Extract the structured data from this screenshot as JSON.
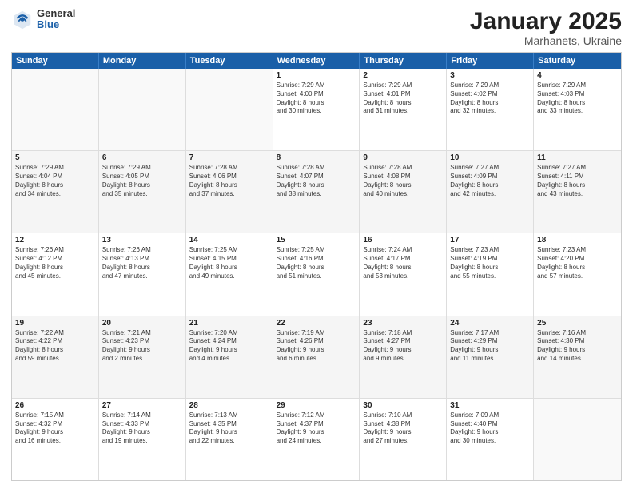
{
  "header": {
    "logo": {
      "general": "General",
      "blue": "Blue"
    },
    "title": "January 2025",
    "location": "Marhanets, Ukraine"
  },
  "days_of_week": [
    "Sunday",
    "Monday",
    "Tuesday",
    "Wednesday",
    "Thursday",
    "Friday",
    "Saturday"
  ],
  "weeks": [
    [
      {
        "day": "",
        "content": ""
      },
      {
        "day": "",
        "content": ""
      },
      {
        "day": "",
        "content": ""
      },
      {
        "day": "1",
        "content": "Sunrise: 7:29 AM\nSunset: 4:00 PM\nDaylight: 8 hours\nand 30 minutes."
      },
      {
        "day": "2",
        "content": "Sunrise: 7:29 AM\nSunset: 4:01 PM\nDaylight: 8 hours\nand 31 minutes."
      },
      {
        "day": "3",
        "content": "Sunrise: 7:29 AM\nSunset: 4:02 PM\nDaylight: 8 hours\nand 32 minutes."
      },
      {
        "day": "4",
        "content": "Sunrise: 7:29 AM\nSunset: 4:03 PM\nDaylight: 8 hours\nand 33 minutes."
      }
    ],
    [
      {
        "day": "5",
        "content": "Sunrise: 7:29 AM\nSunset: 4:04 PM\nDaylight: 8 hours\nand 34 minutes."
      },
      {
        "day": "6",
        "content": "Sunrise: 7:29 AM\nSunset: 4:05 PM\nDaylight: 8 hours\nand 35 minutes."
      },
      {
        "day": "7",
        "content": "Sunrise: 7:28 AM\nSunset: 4:06 PM\nDaylight: 8 hours\nand 37 minutes."
      },
      {
        "day": "8",
        "content": "Sunrise: 7:28 AM\nSunset: 4:07 PM\nDaylight: 8 hours\nand 38 minutes."
      },
      {
        "day": "9",
        "content": "Sunrise: 7:28 AM\nSunset: 4:08 PM\nDaylight: 8 hours\nand 40 minutes."
      },
      {
        "day": "10",
        "content": "Sunrise: 7:27 AM\nSunset: 4:09 PM\nDaylight: 8 hours\nand 42 minutes."
      },
      {
        "day": "11",
        "content": "Sunrise: 7:27 AM\nSunset: 4:11 PM\nDaylight: 8 hours\nand 43 minutes."
      }
    ],
    [
      {
        "day": "12",
        "content": "Sunrise: 7:26 AM\nSunset: 4:12 PM\nDaylight: 8 hours\nand 45 minutes."
      },
      {
        "day": "13",
        "content": "Sunrise: 7:26 AM\nSunset: 4:13 PM\nDaylight: 8 hours\nand 47 minutes."
      },
      {
        "day": "14",
        "content": "Sunrise: 7:25 AM\nSunset: 4:15 PM\nDaylight: 8 hours\nand 49 minutes."
      },
      {
        "day": "15",
        "content": "Sunrise: 7:25 AM\nSunset: 4:16 PM\nDaylight: 8 hours\nand 51 minutes."
      },
      {
        "day": "16",
        "content": "Sunrise: 7:24 AM\nSunset: 4:17 PM\nDaylight: 8 hours\nand 53 minutes."
      },
      {
        "day": "17",
        "content": "Sunrise: 7:23 AM\nSunset: 4:19 PM\nDaylight: 8 hours\nand 55 minutes."
      },
      {
        "day": "18",
        "content": "Sunrise: 7:23 AM\nSunset: 4:20 PM\nDaylight: 8 hours\nand 57 minutes."
      }
    ],
    [
      {
        "day": "19",
        "content": "Sunrise: 7:22 AM\nSunset: 4:22 PM\nDaylight: 8 hours\nand 59 minutes."
      },
      {
        "day": "20",
        "content": "Sunrise: 7:21 AM\nSunset: 4:23 PM\nDaylight: 9 hours\nand 2 minutes."
      },
      {
        "day": "21",
        "content": "Sunrise: 7:20 AM\nSunset: 4:24 PM\nDaylight: 9 hours\nand 4 minutes."
      },
      {
        "day": "22",
        "content": "Sunrise: 7:19 AM\nSunset: 4:26 PM\nDaylight: 9 hours\nand 6 minutes."
      },
      {
        "day": "23",
        "content": "Sunrise: 7:18 AM\nSunset: 4:27 PM\nDaylight: 9 hours\nand 9 minutes."
      },
      {
        "day": "24",
        "content": "Sunrise: 7:17 AM\nSunset: 4:29 PM\nDaylight: 9 hours\nand 11 minutes."
      },
      {
        "day": "25",
        "content": "Sunrise: 7:16 AM\nSunset: 4:30 PM\nDaylight: 9 hours\nand 14 minutes."
      }
    ],
    [
      {
        "day": "26",
        "content": "Sunrise: 7:15 AM\nSunset: 4:32 PM\nDaylight: 9 hours\nand 16 minutes."
      },
      {
        "day": "27",
        "content": "Sunrise: 7:14 AM\nSunset: 4:33 PM\nDaylight: 9 hours\nand 19 minutes."
      },
      {
        "day": "28",
        "content": "Sunrise: 7:13 AM\nSunset: 4:35 PM\nDaylight: 9 hours\nand 22 minutes."
      },
      {
        "day": "29",
        "content": "Sunrise: 7:12 AM\nSunset: 4:37 PM\nDaylight: 9 hours\nand 24 minutes."
      },
      {
        "day": "30",
        "content": "Sunrise: 7:10 AM\nSunset: 4:38 PM\nDaylight: 9 hours\nand 27 minutes."
      },
      {
        "day": "31",
        "content": "Sunrise: 7:09 AM\nSunset: 4:40 PM\nDaylight: 9 hours\nand 30 minutes."
      },
      {
        "day": "",
        "content": ""
      }
    ]
  ]
}
